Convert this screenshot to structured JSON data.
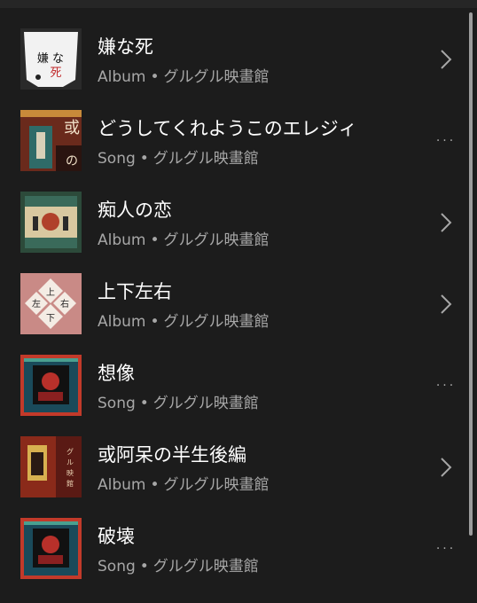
{
  "results": [
    {
      "title": "嫌な死",
      "type": "Album",
      "artist": "グルグル映畫館",
      "action_icon": "chevron-right-icon",
      "art": "cover-iyana-shi",
      "art_text": "嫌な死"
    },
    {
      "title": "どうしてくれようこのエレジィ",
      "type": "Song",
      "artist": "グルグル映畫館",
      "action_icon": "more-icon",
      "art": "cover-aru",
      "art_text": "或"
    },
    {
      "title": "痴人の恋",
      "type": "Album",
      "artist": "グルグル映畫館",
      "action_icon": "chevron-right-icon",
      "art": "cover-chijin",
      "art_text": ""
    },
    {
      "title": "上下左右",
      "type": "Album",
      "artist": "グルグル映畫館",
      "action_icon": "chevron-right-icon",
      "art": "cover-joge",
      "art_text": "上下左右"
    },
    {
      "title": "想像",
      "type": "Song",
      "artist": "グルグル映畫館",
      "action_icon": "more-icon",
      "art": "cover-sozo",
      "art_text": ""
    },
    {
      "title": "或阿呆の半生後編",
      "type": "Album",
      "artist": "グルグル映畫館",
      "action_icon": "chevron-right-icon",
      "art": "cover-aho",
      "art_text": "グルグル映畫館"
    },
    {
      "title": "破壊",
      "type": "Song",
      "artist": "グルグル映畫館",
      "action_icon": "more-icon",
      "art": "cover-hakai",
      "art_text": ""
    }
  ],
  "separator": "•",
  "more_label": "···"
}
